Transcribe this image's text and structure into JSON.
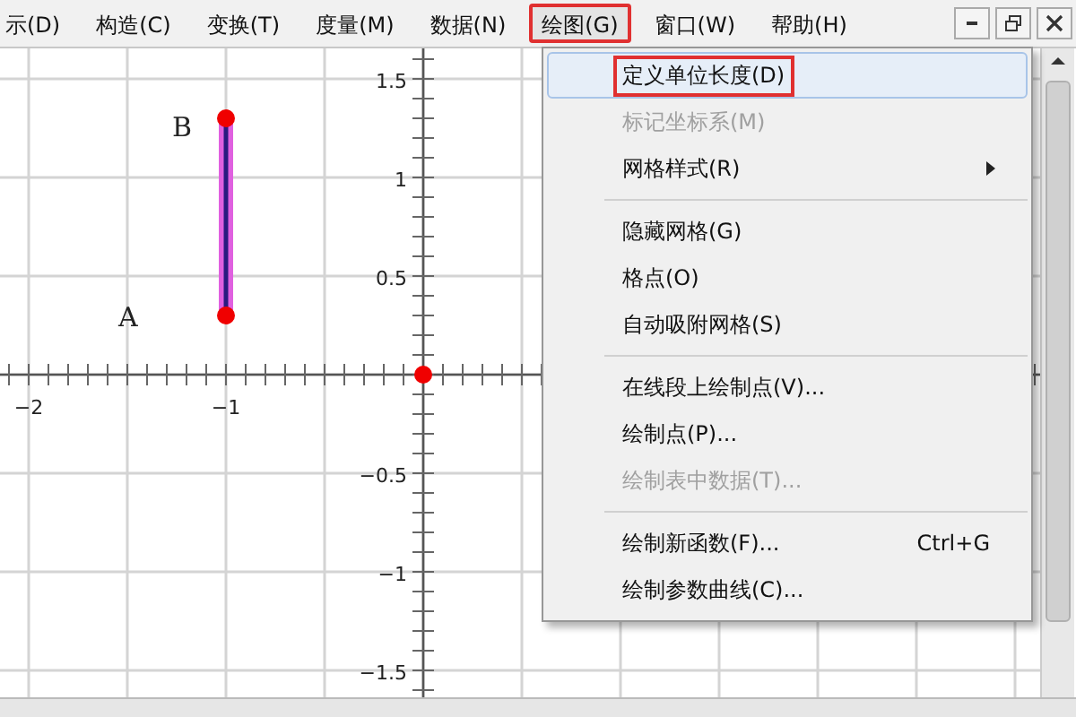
{
  "menu_bar": {
    "items": [
      {
        "label": "示(D)",
        "selected": false,
        "marked": false
      },
      {
        "label": "构造(C)",
        "selected": false,
        "marked": false
      },
      {
        "label": "变换(T)",
        "selected": false,
        "marked": false
      },
      {
        "label": "度量(M)",
        "selected": false,
        "marked": false
      },
      {
        "label": "数据(N)",
        "selected": false,
        "marked": false
      },
      {
        "label": "绘图(G)",
        "selected": true,
        "marked": true
      },
      {
        "label": "窗口(W)",
        "selected": false,
        "marked": false
      },
      {
        "label": "帮助(H)",
        "selected": false,
        "marked": false
      }
    ]
  },
  "canvas": {
    "x_tick_labels": [
      "−2",
      "−1"
    ],
    "y_tick_labels": [
      "1.5",
      "1",
      "0.5",
      "−0.5",
      "−1",
      "−1.5"
    ],
    "point_labels": [
      "B",
      "A"
    ]
  },
  "dropdown_menu": {
    "sections": [
      [
        {
          "label": "定义单位长度(D)",
          "selected": true,
          "marked": true,
          "disabled": false
        },
        {
          "label": "标记坐标系(M)",
          "selected": false,
          "marked": false,
          "disabled": true
        },
        {
          "label": "网格样式(R)",
          "selected": false,
          "marked": false,
          "disabled": false,
          "submenu": true
        }
      ],
      [
        {
          "label": "隐藏网格(G)",
          "selected": false,
          "marked": false,
          "disabled": false
        },
        {
          "label": "格点(O)",
          "selected": false,
          "marked": false,
          "disabled": false
        },
        {
          "label": "自动吸附网格(S)",
          "selected": false,
          "marked": false,
          "disabled": false
        }
      ],
      [
        {
          "label": "在线段上绘制点(V)...",
          "selected": false,
          "marked": false,
          "disabled": false
        },
        {
          "label": "绘制点(P)...",
          "selected": false,
          "marked": false,
          "disabled": false
        },
        {
          "label": "绘制表中数据(T)...",
          "selected": false,
          "marked": false,
          "disabled": true
        }
      ],
      [
        {
          "label": "绘制新函数(F)...",
          "selected": false,
          "marked": false,
          "disabled": false,
          "shortcut": "Ctrl+G"
        },
        {
          "label": "绘制参数曲线(C)...",
          "selected": false,
          "marked": false,
          "disabled": false
        }
      ]
    ]
  }
}
